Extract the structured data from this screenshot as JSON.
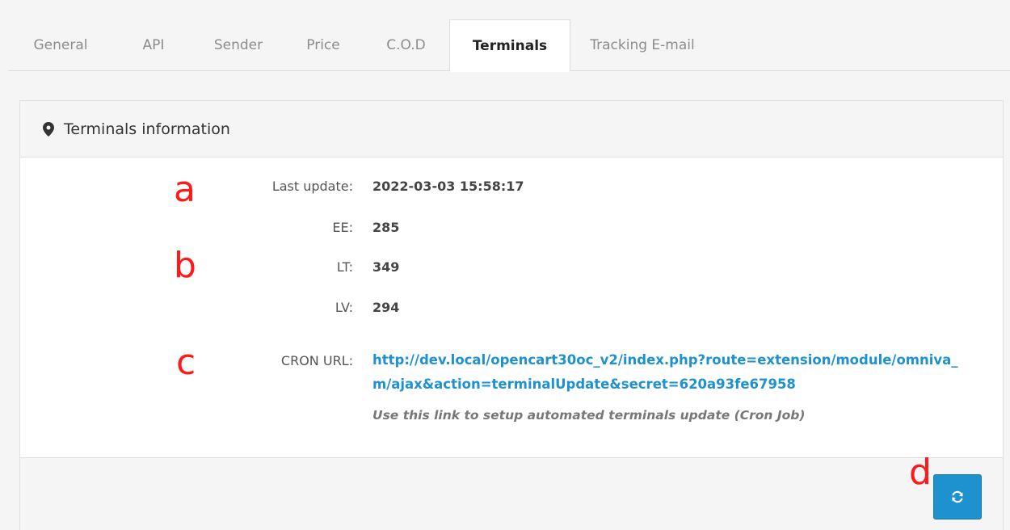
{
  "tabs": [
    {
      "label": "General",
      "active": false
    },
    {
      "label": "API",
      "active": false
    },
    {
      "label": "Sender",
      "active": false
    },
    {
      "label": "Price",
      "active": false
    },
    {
      "label": "C.O.D",
      "active": false
    },
    {
      "label": "Terminals",
      "active": true
    },
    {
      "label": "Tracking E-mail",
      "active": false
    }
  ],
  "panel": {
    "title": "Terminals information",
    "title_icon": "map-marker-icon"
  },
  "info": {
    "last_update_label": "Last update:",
    "last_update_value": "2022-03-03 15:58:17",
    "ee_label": "EE:",
    "ee_value": "285",
    "lt_label": "LT:",
    "lt_value": "349",
    "lv_label": "LV:",
    "lv_value": "294",
    "cron_label": "CRON URL:",
    "cron_url": "http://dev.local/opencart30oc_v2/index.php?route=extension/module/omniva_m/ajax&action=terminalUpdate&secret=620a93fe67958",
    "cron_help": "Use this link to setup automated terminals update (Cron Job)"
  },
  "markers": {
    "a": "a",
    "b": "b",
    "c": "c",
    "d": "d"
  },
  "footer": {
    "refresh_icon": "refresh-icon"
  },
  "colors": {
    "accent": "#1e91cf",
    "marker": "#ff1a1a"
  }
}
